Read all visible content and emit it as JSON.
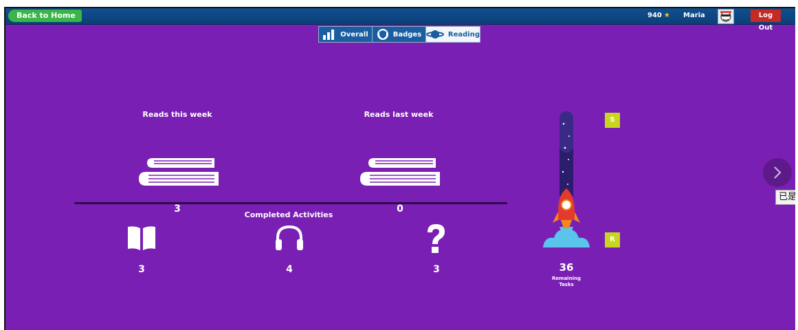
{
  "header": {
    "back_label": "Back to Home",
    "stars": "940",
    "user_name": "Maria",
    "logout_label": "Log Out"
  },
  "tabs": [
    {
      "label": "Overall",
      "icon": "bar-chart-icon",
      "active": false
    },
    {
      "label": "Badges",
      "icon": "shield-icon",
      "active": false
    },
    {
      "label": "Reading",
      "icon": "planet-icon",
      "active": true
    }
  ],
  "reads": {
    "this_week_label": "Reads this week",
    "this_week_value": "3",
    "last_week_label": "Reads last week",
    "last_week_value": "0"
  },
  "activities": {
    "title": "Completed Activities",
    "read_count": "3",
    "listen_count": "4",
    "quiz_count": "3"
  },
  "progress": {
    "top_level": "S",
    "current_level": "R",
    "remaining_count": "36",
    "remaining_label_1": "Remaining",
    "remaining_label_2": "Tasks"
  },
  "tooltip": {
    "text": "已是"
  },
  "colors": {
    "background": "#7a1fb3",
    "topbar": "#0f4f8f",
    "back_button": "#39b54a",
    "logout_button": "#c52a25",
    "level_badge": "#c8d620"
  }
}
